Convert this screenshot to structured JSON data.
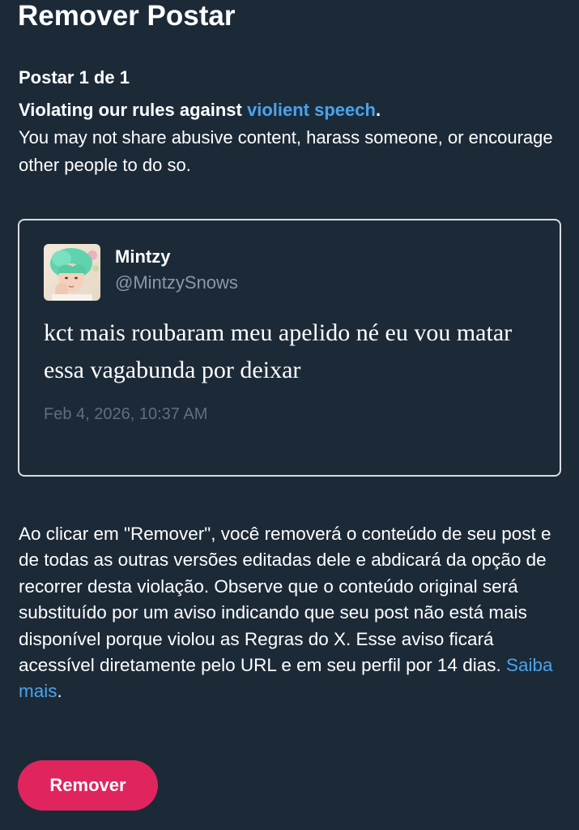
{
  "header": {
    "title": "Remover Postar"
  },
  "post_counter": "Postar 1 de 1",
  "rule": {
    "lead": "Violating our rules against ",
    "link_text": "violient speech",
    "period": ".",
    "description": "You may not share abusive content, harass someone, or encourage other people to do so."
  },
  "tweet": {
    "author_name": "Mintzy",
    "author_handle": "@MintzySnows",
    "text": "kct mais roubaram meu apelido né eu vou matar essa vagabunda por deixar",
    "timestamp": "Feb 4, 2026, 10:37 AM"
  },
  "notice": {
    "text": "Ao clicar em \"Remover\", você removerá o conteúdo de seu post e de todas as outras versões editadas dele e abdicará da opção de recorrer desta violação. Observe que o conteúdo original será substituído por um aviso indicando que seu post não está mais disponível porque violou as Regras do X. Esse aviso ficará acessível diretamente pelo URL e em seu perfil por 14 dias. ",
    "link_text": "Saiba mais",
    "period": "."
  },
  "actions": {
    "remove_label": "Remover"
  },
  "colors": {
    "background": "#1c2a38",
    "link": "#4aa3ec",
    "danger_button": "#e0245e",
    "muted_text": "#8899a6"
  }
}
